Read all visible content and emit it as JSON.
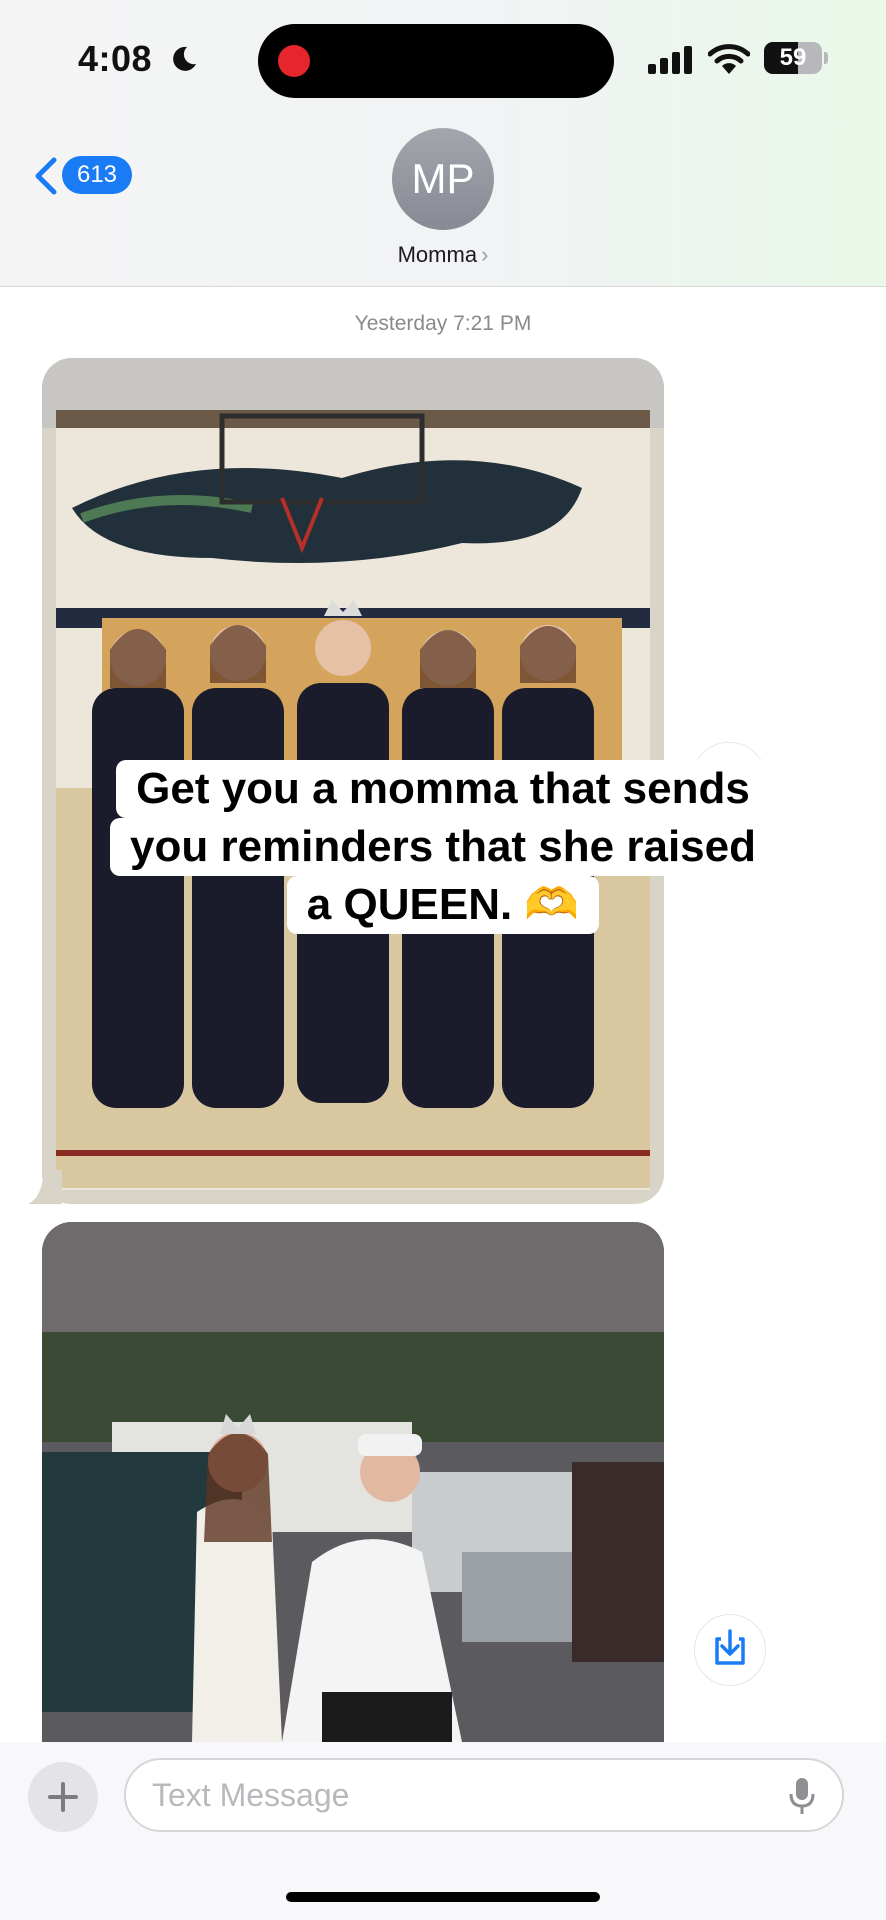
{
  "status_bar": {
    "time": "4:08",
    "battery": "59",
    "battery_level": 0.59
  },
  "header": {
    "back_count": "613",
    "avatar_initials": "MP",
    "contact_name": "Momma"
  },
  "thread": {
    "timestamp": "Yesterday 7:21 PM"
  },
  "overlay": {
    "lines": [
      "Get you a momma that sends",
      "you reminders that she raised",
      "a QUEEN. 🫶"
    ]
  },
  "compose": {
    "placeholder": "Text Message"
  }
}
